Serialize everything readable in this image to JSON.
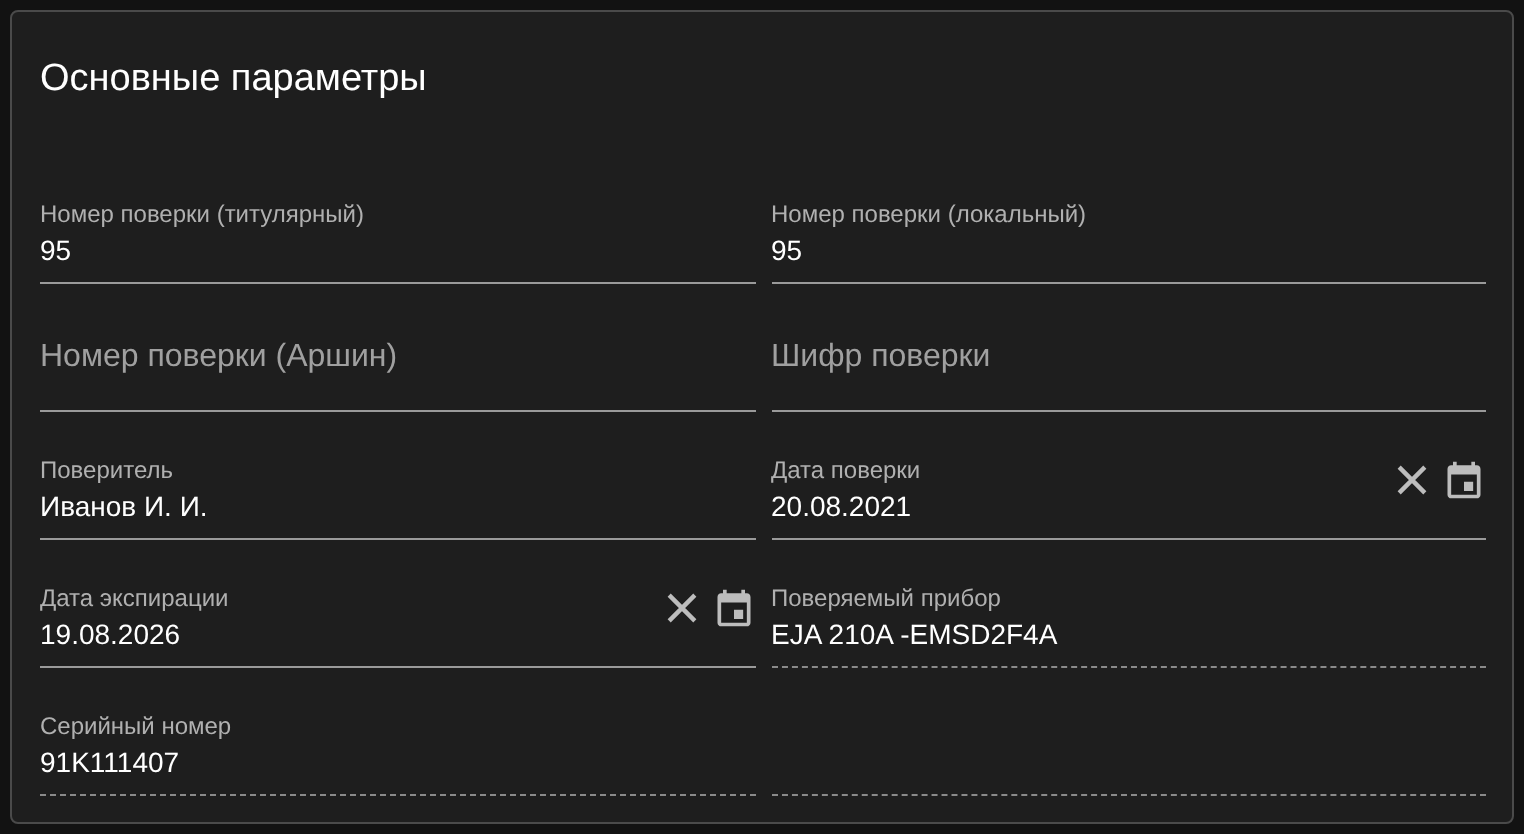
{
  "card": {
    "title": "Основные параметры"
  },
  "fields": [
    {
      "kind": "text",
      "label": "Номер поверки (титулярный)",
      "value": "95",
      "disabled": false
    },
    {
      "kind": "text",
      "label": "Номер поверки (локальный)",
      "value": "95",
      "disabled": false
    },
    {
      "kind": "text",
      "placeholder": "Номер поверки (Аршин)",
      "disabled": false
    },
    {
      "kind": "text",
      "placeholder": "Шифр поверки",
      "disabled": false
    },
    {
      "kind": "text",
      "label": "Поверитель",
      "value": "Иванов И. И.",
      "disabled": false
    },
    {
      "kind": "date",
      "label": "Дата поверки",
      "value": "20.08.2021",
      "disabled": false
    },
    {
      "kind": "date",
      "label": "Дата экспирации",
      "value": "19.08.2026",
      "disabled": false
    },
    {
      "kind": "text",
      "label": "Поверяемый прибор",
      "value": "EJA 210A -EMSD2F4A",
      "disabled": true
    },
    {
      "kind": "text",
      "label": "Серийный номер",
      "value": "91K111407",
      "disabled": true
    },
    {
      "kind": "text",
      "disabled": true
    }
  ]
}
